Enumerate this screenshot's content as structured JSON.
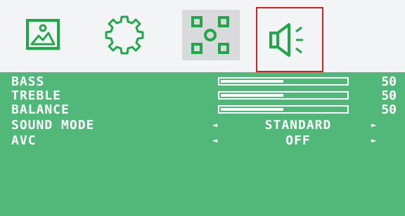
{
  "tabs": [
    {
      "id": "picture",
      "icon": "picture-icon"
    },
    {
      "id": "setup",
      "icon": "gear-icon"
    },
    {
      "id": "options",
      "icon": "nodes-icon"
    },
    {
      "id": "sound",
      "icon": "speaker-icon"
    }
  ],
  "sound_menu": {
    "bass": {
      "label": "BASS",
      "value": "50",
      "level": 0.5
    },
    "treble": {
      "label": "TREBLE",
      "value": "50",
      "level": 0.5
    },
    "balance": {
      "label": "BALANCE",
      "value": "50",
      "level": 0.5
    },
    "sound_mode": {
      "label": "SOUND MODE",
      "value": "STANDARD",
      "arrow_left": "◄",
      "arrow_right": "►"
    },
    "avc": {
      "label": "AVC",
      "value": "OFF",
      "arrow_left": "◄",
      "arrow_right": "►"
    }
  },
  "colors": {
    "accent": "#22a64a",
    "panel": "#52b87a",
    "selection": "#d32020"
  }
}
